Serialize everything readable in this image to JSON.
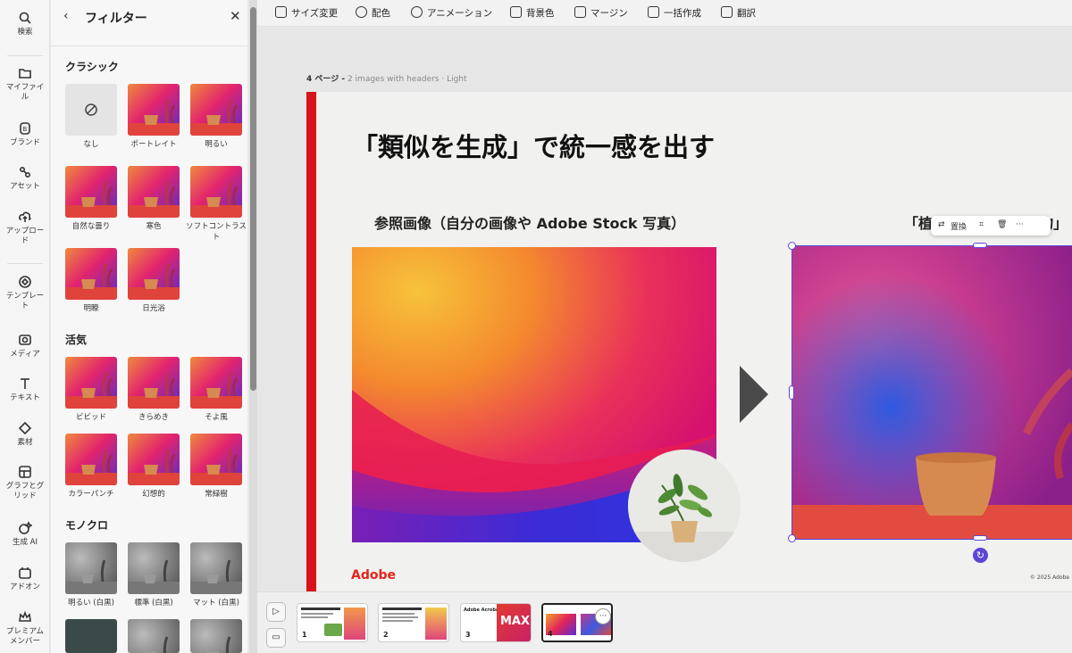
{
  "rail": {
    "items": [
      {
        "label": "検索",
        "icon": "search-icon"
      },
      {
        "label": "マイファイル",
        "icon": "folder-icon"
      },
      {
        "label": "ブランド",
        "icon": "brand-icon"
      },
      {
        "label": "アセット",
        "icon": "assets-icon"
      },
      {
        "label": "アップロード",
        "icon": "upload-icon"
      },
      {
        "label": "テンプレート",
        "icon": "template-icon"
      },
      {
        "label": "メディア",
        "icon": "media-icon"
      },
      {
        "label": "テキスト",
        "icon": "text-icon"
      },
      {
        "label": "素材",
        "icon": "elements-icon"
      },
      {
        "label": "グラフとグリッド",
        "icon": "grid-icon"
      },
      {
        "label": "生成 AI",
        "icon": "generative-ai-icon"
      },
      {
        "label": "アドオン",
        "icon": "addon-icon"
      },
      {
        "label": "プレミアムメンバー",
        "icon": "crown-icon"
      }
    ]
  },
  "panel": {
    "title": "フィルター",
    "sections": {
      "classic": {
        "title": "クラシック",
        "filters": [
          "なし",
          "ポートレイト",
          "明るい",
          "自然な曇り",
          "寒色",
          "ソフトコントラスト",
          "明瞭",
          "日光浴"
        ]
      },
      "vivid": {
        "title": "活気",
        "filters": [
          "ビビッド",
          "きらめき",
          "そよ風",
          "カラーパンチ",
          "幻想的",
          "常緑樹"
        ]
      },
      "mono": {
        "title": "モノクロ",
        "filters": [
          "明るい (白黒)",
          "標準 (白黒)",
          "マット (白黒)"
        ]
      }
    }
  },
  "toolbar": {
    "items": [
      "サイズ変更",
      "配色",
      "アニメーション",
      "背景色",
      "マージン",
      "一括作成",
      "翻訳"
    ]
  },
  "page": {
    "label": "4 ページ -",
    "sublabel": "2 images with headers · Light"
  },
  "slide": {
    "title": "「類似を生成」で統一感を出す",
    "ref_caption": "参照画像（自分の画像や Adobe Stock 写真）",
    "right_caption": "「植",
    "right_caption_end": "物」",
    "logo": "Adobe",
    "copyright": "© 2025 Adobe"
  },
  "float_bar": {
    "replace": "置換"
  },
  "thumbs": [
    {
      "num": "1"
    },
    {
      "num": "2"
    },
    {
      "num": "3",
      "title": "Adobe Acrobat",
      "max_text": "MAX"
    },
    {
      "num": "4"
    }
  ],
  "colors": {
    "accent_red": "#d7141a",
    "selection": "#5b46d6"
  }
}
